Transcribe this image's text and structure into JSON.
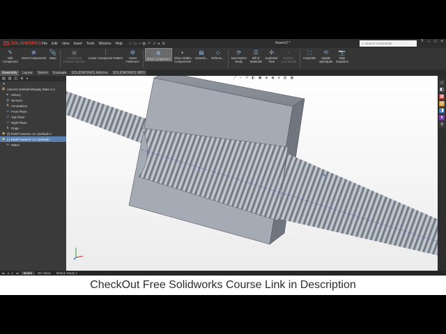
{
  "app": {
    "logo_ds": "3S",
    "logo_text": "SOLIDWORKS",
    "menu": [
      "File",
      "Edit",
      "View",
      "Insert",
      "Tools",
      "Window",
      "Help"
    ],
    "qat_icons": [
      "new-icon",
      "open-icon",
      "save-icon",
      "print-icon",
      "undo-icon",
      "select-icon",
      "rebuild-icon",
      "options-icon"
    ],
    "doc_title": "Assem2 *",
    "search_placeholder": "Search Commands",
    "window_controls": [
      "?",
      "–",
      "□",
      "×"
    ]
  },
  "ribbon": {
    "tools": [
      {
        "name": "edit-component",
        "label": "Edit\nComponent",
        "icon": "✎",
        "dim": false
      },
      {
        "name": "insert-components",
        "label": "Insert Components",
        "icon": "⊕",
        "dim": false
      },
      {
        "name": "mate",
        "label": "Mate",
        "icon": "📎",
        "dim": false
      },
      {
        "name": "component-preview-window",
        "label": "Component\nPreview Window",
        "icon": "▣",
        "dim": true
      },
      {
        "name": "linear-component-pattern",
        "label": "Linear Component Pattern",
        "icon": "⁞",
        "dim": false
      },
      {
        "name": "smart-fasteners",
        "label": "Smart\nFasteners",
        "icon": "⚙",
        "dim": false
      },
      {
        "name": "move-component",
        "label": "Move Component",
        "icon": "✥",
        "dim": false,
        "active": true
      },
      {
        "name": "show-hidden-components",
        "label": "Show Hidden\nComponents",
        "icon": "◐",
        "dim": false
      },
      {
        "name": "assembly-features",
        "label": "Assemb...",
        "icon": "▤",
        "dim": false
      },
      {
        "name": "reference-geometry",
        "label": "Referen...",
        "icon": "◇",
        "dim": false
      },
      {
        "name": "new-motion-study",
        "label": "New Motion\nStudy",
        "icon": "⟳",
        "dim": false
      },
      {
        "name": "bill-of-materials",
        "label": "Bill of\nMaterials",
        "icon": "☰",
        "dim": false
      },
      {
        "name": "exploded-view",
        "label": "Exploded\nView",
        "icon": "✣",
        "dim": false
      },
      {
        "name": "explode-line-sketch",
        "label": "Explode\nLine Sketch",
        "icon": "⌁",
        "dim": true
      },
      {
        "name": "instant3d",
        "label": "Instant3D",
        "icon": "⬚",
        "dim": false
      },
      {
        "name": "update-speedpak",
        "label": "Update\nSpeedpak",
        "icon": "⟲",
        "dim": false
      },
      {
        "name": "take-snapshot",
        "label": "Take\nSnapshot",
        "icon": "📷",
        "dim": false
      }
    ]
  },
  "tabs": [
    "Assembly",
    "Layout",
    "Sketch",
    "Evaluate",
    "SOLIDWORKS Add-Ins",
    "SOLIDWORKS MBD"
  ],
  "active_tab": "Assembly",
  "tree": {
    "toolbar_icons": [
      "feature-manager-icon",
      "property-manager-icon",
      "configuration-manager-icon",
      "dimxpert-icon",
      "display-manager-icon"
    ],
    "filter_icon": "filter-icon",
    "items": [
      {
        "label": "Assem2  (Default<Display State-1>)",
        "icon": "▦",
        "color": "#c9a36a",
        "indent": 2
      },
      {
        "label": "History",
        "icon": "▸",
        "color": "#9fc3e8",
        "indent": 8
      },
      {
        "label": "Sensors",
        "icon": "◎",
        "color": "#9fc3e8",
        "indent": 8
      },
      {
        "label": "Annotations",
        "icon": "A",
        "color": "#e0c070",
        "indent": 8
      },
      {
        "label": "Front Plane",
        "icon": "▱",
        "color": "#9fc3e8",
        "indent": 8
      },
      {
        "label": "Top Plane",
        "icon": "▱",
        "color": "#9fc3e8",
        "indent": 8
      },
      {
        "label": "Right Plane",
        "icon": "▱",
        "color": "#9fc3e8",
        "indent": 8
      },
      {
        "label": "Origin",
        "icon": "↳",
        "color": "#e0e0e0",
        "indent": 8
      },
      {
        "label": "(f) Part8^Assem2 <1> (Default<<",
        "icon": "◆",
        "color": "#e8c060",
        "indent": 2
      },
      {
        "label": "(-) Part9^Assem2 <1> (Default<",
        "icon": "◆",
        "color": "#e8c060",
        "indent": 2,
        "selected": true
      },
      {
        "label": "Mates",
        "icon": "∞",
        "color": "#9fc3e8",
        "indent": 8
      }
    ]
  },
  "headsup_icons": [
    "zoom-fit-icon",
    "zoom-area-icon",
    "previous-view-icon",
    "section-view-icon",
    "view-orientation-icon",
    "display-style-icon",
    "hide-show-icon",
    "appearance-icon",
    "scene-icon",
    "view-settings-icon"
  ],
  "taskpane_icons": [
    {
      "name": "home-icon",
      "glyph": "⌂",
      "color": "#3e3e3e"
    },
    {
      "name": "resources-icon",
      "glyph": "◧",
      "color": "#3e3e3e"
    },
    {
      "name": "design-library-icon",
      "glyph": "▦",
      "color": "#b03a2e"
    },
    {
      "name": "file-explorer-icon",
      "glyph": "▤",
      "color": "#c9902a"
    },
    {
      "name": "view-palette-icon",
      "glyph": "◨",
      "color": "#3a6aa8"
    },
    {
      "name": "appearances-icon",
      "glyph": "●",
      "color": "#7a3aa8"
    },
    {
      "name": "custom-properties-icon",
      "glyph": "≡",
      "color": "#3e3e3e"
    }
  ],
  "bottom_tabs": {
    "nav": [
      "◂◂",
      "◂",
      "▸",
      "▸▸"
    ],
    "tabs": [
      "Model",
      "3D Views",
      "Motion Study 1"
    ],
    "active": "Model"
  },
  "caption": "CheckOut Free Solidworks Course Link in Description"
}
